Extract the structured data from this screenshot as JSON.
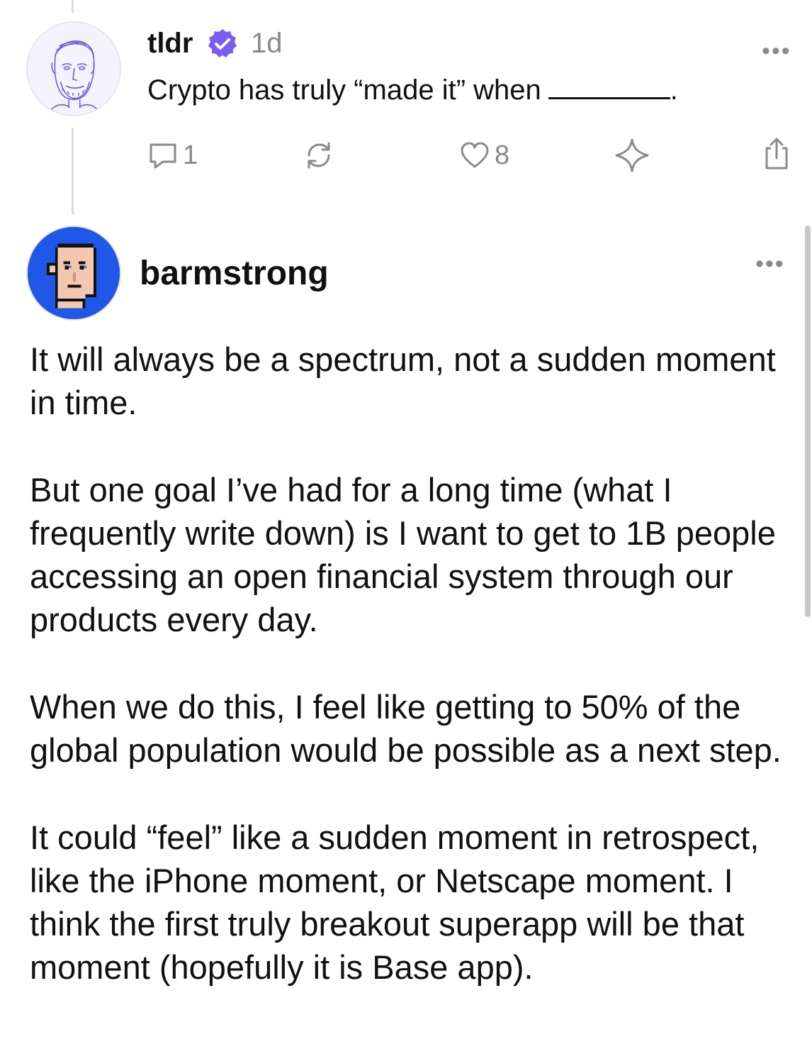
{
  "post": {
    "username": "tldr",
    "verified_icon": "verified-badge-icon",
    "time": "1d",
    "text": "Crypto has truly “made it” when",
    "text_end": ".",
    "actions": {
      "reply_count": "1",
      "like_count": "8"
    },
    "more_label": "•••"
  },
  "reply": {
    "username": "barmstrong",
    "more_label": "•••",
    "paragraphs": [
      "It will always be a spectrum, not a sudden moment in time.",
      "But one goal I’ve had for a long time (what I frequently write down) is I want to get to 1B people accessing an open financial system through our products every day.",
      "When we do this, I feel like getting to 50% of the global population would be possible as a next step.",
      "It could “feel” like a sudden moment in retrospect, like the iPhone moment, or Netscape moment. I think the first truly breakout superapp will be that moment (hopefully it is Base app)."
    ]
  },
  "colors": {
    "verified": "#7b5cf0",
    "barmstrong_avatar_bg": "#1f57e8",
    "muted": "#8a8a8a"
  }
}
